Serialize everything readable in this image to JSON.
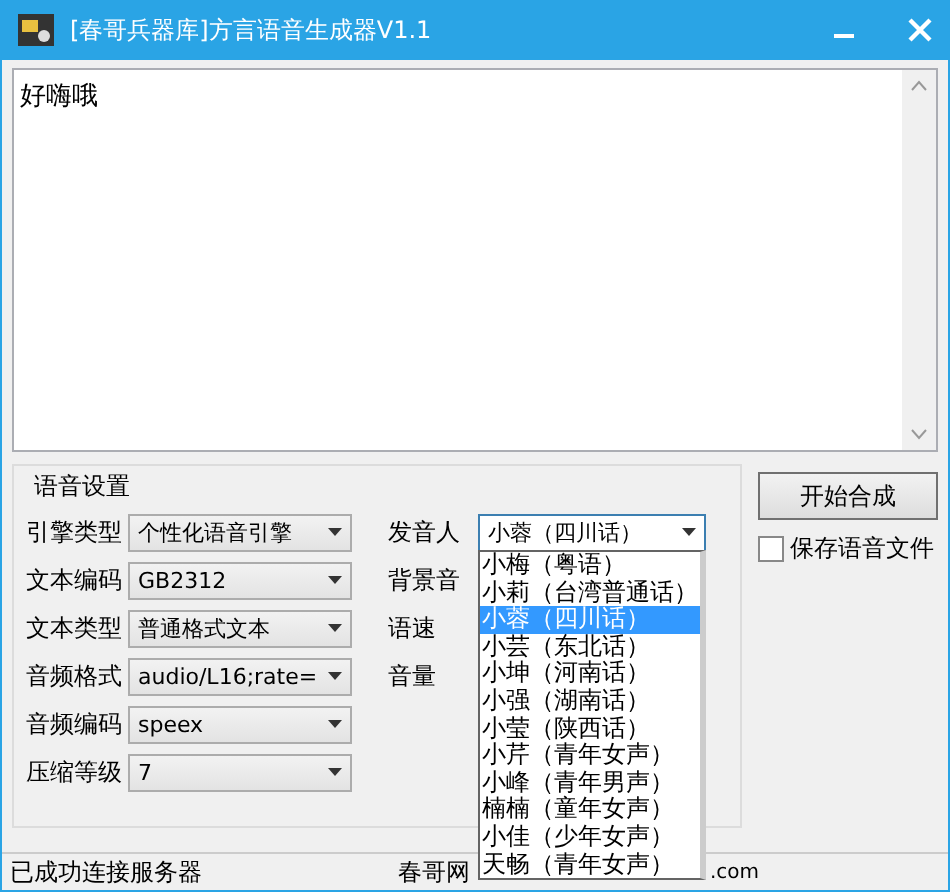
{
  "window": {
    "title": "[春哥兵器库]方言语音生成器V1.1"
  },
  "text_input": {
    "value": "好嗨哦"
  },
  "settings": {
    "title": "语音设置",
    "left_fields": [
      {
        "label": "引擎类型",
        "value": "个性化语音引擎"
      },
      {
        "label": "文本编码",
        "value": "GB2312"
      },
      {
        "label": "文本类型",
        "value": "普通格式文本"
      },
      {
        "label": "音频格式",
        "value": "audio/L16;rate="
      },
      {
        "label": "音频编码",
        "value": "speex"
      },
      {
        "label": "压缩等级",
        "value": "7"
      }
    ],
    "right_fields": [
      {
        "label": "发音人",
        "value": "小蓉（四川话）",
        "open": true
      },
      {
        "label": "背景音"
      },
      {
        "label": "语速"
      },
      {
        "label": "音量"
      }
    ],
    "speaker_options": [
      {
        "label": "小梅（粤语）",
        "selected": false
      },
      {
        "label": "小莉（台湾普通话）",
        "selected": false
      },
      {
        "label": "小蓉（四川话）",
        "selected": true
      },
      {
        "label": "小芸（东北话）",
        "selected": false
      },
      {
        "label": "小坤（河南话）",
        "selected": false
      },
      {
        "label": "小强（湖南话）",
        "selected": false
      },
      {
        "label": "小莹（陕西话）",
        "selected": false
      },
      {
        "label": "小芹（青年女声）",
        "selected": false
      },
      {
        "label": "小峰（青年男声）",
        "selected": false
      },
      {
        "label": "楠楠（童年女声）",
        "selected": false
      },
      {
        "label": "小佳（少年女声）",
        "selected": false
      },
      {
        "label": "天畅（青年女声）",
        "selected": false
      }
    ],
    "start_button": "开始合成",
    "save_checkbox": {
      "label": "保存语音文件",
      "checked": false
    }
  },
  "status_bar": {
    "left": "已成功连接服务器",
    "middle": "春哥网",
    "right": ".com"
  }
}
